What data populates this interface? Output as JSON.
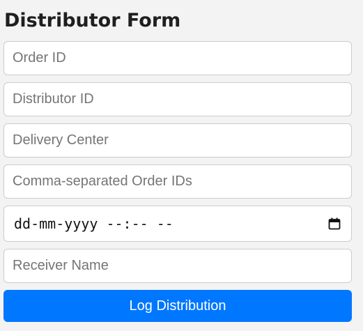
{
  "form": {
    "title": "Distributor Form",
    "fields": {
      "order_id": {
        "placeholder": "Order ID",
        "value": ""
      },
      "distributor_id": {
        "placeholder": "Distributor ID",
        "value": ""
      },
      "delivery_center": {
        "placeholder": "Delivery Center",
        "value": ""
      },
      "order_ids": {
        "placeholder": "Comma-separated Order IDs",
        "value": ""
      },
      "delivery_datetime": {
        "display": "dd-mm-yyyy --:-- --"
      },
      "receiver_name": {
        "placeholder": "Receiver Name",
        "value": ""
      }
    },
    "submit_label": "Log Distribution"
  },
  "icons": {
    "calendar": "calendar-icon"
  },
  "colors": {
    "background": "#f3f3f3",
    "accent": "#0077ff",
    "field_border": "#cccccc"
  }
}
